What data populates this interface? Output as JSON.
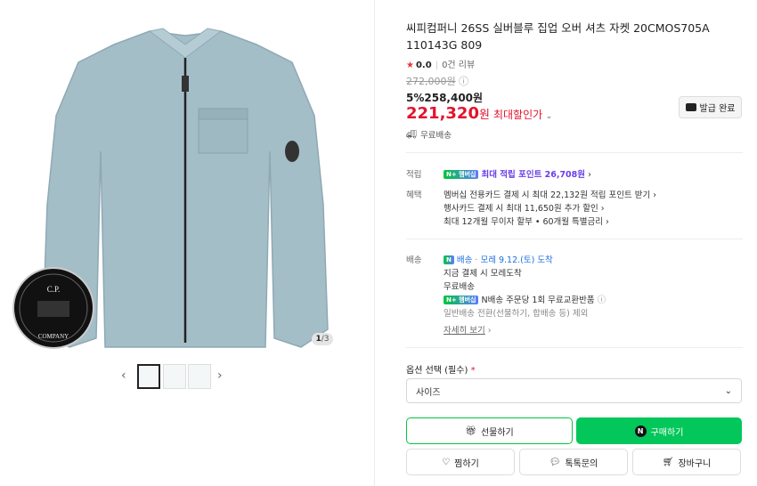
{
  "gallery": {
    "counter_current": "1",
    "counter_total": "/3",
    "prev_arrow": "‹",
    "next_arrow": "›",
    "logo_text_top": "C.P.",
    "logo_text_bottom": "COMPANY"
  },
  "product": {
    "title": "씨피컴퍼니 26SS 실버블루 집업 오버 셔츠 자켓 20CMOS705A 110143G 809",
    "rating": "0.0",
    "review_count": "0건 리뷰",
    "original_price": "272,000원",
    "discount_rate": "5%",
    "discount_price": "258,400원",
    "best_price": "221,320",
    "best_price_unit": "원",
    "best_price_label": "최대할인가",
    "coupon_button": "발급 완료",
    "shipping_free": "무료배송"
  },
  "benefits": {
    "points_label": "적립",
    "points_badge": "N+ 멤버십",
    "points_text": "최대 적립 포인트 26,708원",
    "perks_label": "혜택",
    "perks": [
      "멤버십 전용카드 결제 시 최대 22,132원 적립 포인트 받기",
      "행사카드 결제 시 최대 11,650원 추가 할인",
      "최대 12개월 무이자 할부 • 60개월 특별금리"
    ]
  },
  "delivery": {
    "label": "배송",
    "n_delivery": "배송",
    "arrival": "모레 9.12.(토) 도착",
    "pay_note": "지금 결제 시 모레도착",
    "free": "무료배송",
    "badge": "N+ 멤버십",
    "return_note": "N배송 주문당 1회 무료교환반품",
    "switch_note": "일반배송 전환(선물하기, 합배송 등) 제외",
    "more_link": "자세히 보기"
  },
  "options": {
    "label": "옵션 선택 (필수)",
    "required_mark": "*",
    "select_value": "사이즈"
  },
  "actions": {
    "gift": "선물하기",
    "buy": "구매하기",
    "wish": "찜하기",
    "talk": "톡톡문의",
    "cart": "장바구니"
  },
  "colors": {
    "accent_green": "#03c75a",
    "price_red": "#e3132d",
    "jacket": "#a4bec8"
  }
}
